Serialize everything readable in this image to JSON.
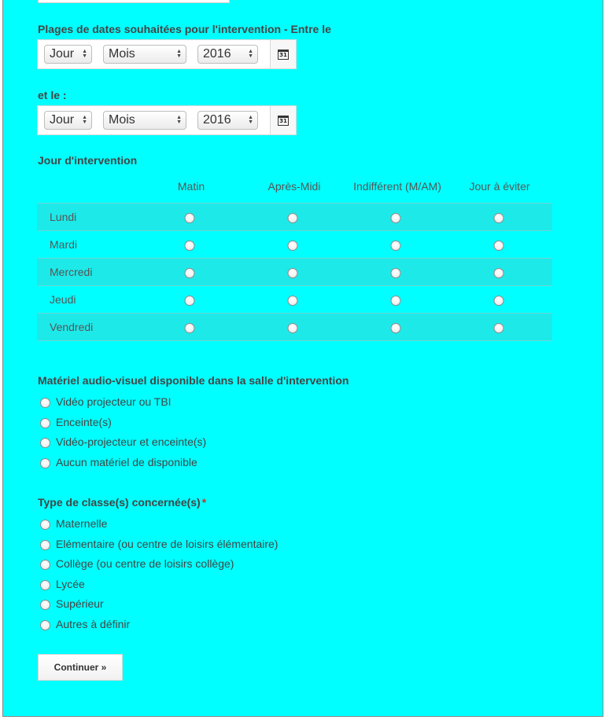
{
  "date_range": {
    "label_start": "Plages de dates souhaitées pour l'intervention - Entre le",
    "label_end": "et le :",
    "start": {
      "day": "Jour",
      "month": "Mois",
      "year": "2016",
      "calendar_glyph": "31"
    },
    "end": {
      "day": "Jour",
      "month": "Mois",
      "year": "2016",
      "calendar_glyph": "31"
    }
  },
  "intervention_days": {
    "label": "Jour d'intervention",
    "columns": [
      "Matin",
      "Après-Midi",
      "Indifférent (M/AM)",
      "Jour à éviter"
    ],
    "rows": [
      "Lundi",
      "Mardi",
      "Mercredi",
      "Jeudi",
      "Vendredi"
    ]
  },
  "equipment": {
    "label": "Matériel audio-visuel disponible dans la salle d'intervention",
    "options": [
      "Vidéo projecteur ou TBI",
      "Enceinte(s)",
      "Vidéo-projecteur et enceinte(s)",
      "Aucun matériel de disponible"
    ]
  },
  "class_type": {
    "label": "Type de classe(s) concernée(s)",
    "required_mark": "*",
    "options": [
      "Maternelle",
      "Elémentaire (ou centre de loisirs élémentaire)",
      "Collège (ou centre de loisirs collège)",
      "Lycée",
      "Supérieur",
      "Autres à définir"
    ]
  },
  "continue_label": "Continuer »",
  "colors": {
    "background": "#00ffff",
    "row_alt": "#1ee9e9"
  }
}
